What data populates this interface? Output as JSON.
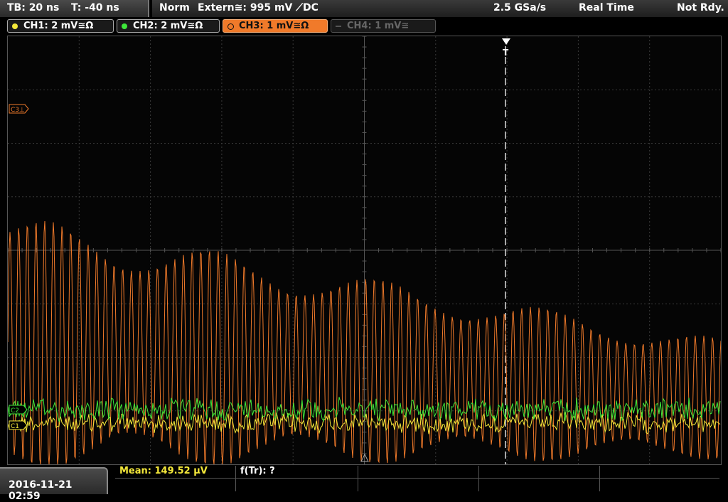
{
  "header": {
    "timebase": "TB: 20 ns",
    "trigger_time": "T: -40 ns",
    "mode": "Norm",
    "trigger": "Extern≅: 995 mV ⟋DC",
    "sample_rate": "2.5 GSa/s",
    "acq_mode": "Real Time",
    "status": "Not Rdy."
  },
  "channels": [
    {
      "label": "CH1: 2 mV≅Ω",
      "color": "#f4e83a",
      "active": true
    },
    {
      "label": "CH2: 2 mV≅Ω",
      "color": "#3ee83a",
      "active": true
    },
    {
      "label": "CH3: 1 mV≅Ω",
      "color": "#f07a2a",
      "active": true,
      "selected": true
    },
    {
      "label": "CH4: 1 mV≅",
      "color": "#666666",
      "active": false
    }
  ],
  "markers": {
    "ch3": "C3⊥",
    "ch2": "C2",
    "ch1": "C1",
    "trigger": "T"
  },
  "footer": {
    "datetime": "2016-11-21 02:59",
    "measurement_mean": "Mean: 149.52 µV",
    "measurement_freq": "f(Tr): ?"
  },
  "colors": {
    "ch1": "#f4e83a",
    "ch2": "#3ee83a",
    "ch3": "#f07a2a",
    "grid": "#3a3a3a"
  }
}
